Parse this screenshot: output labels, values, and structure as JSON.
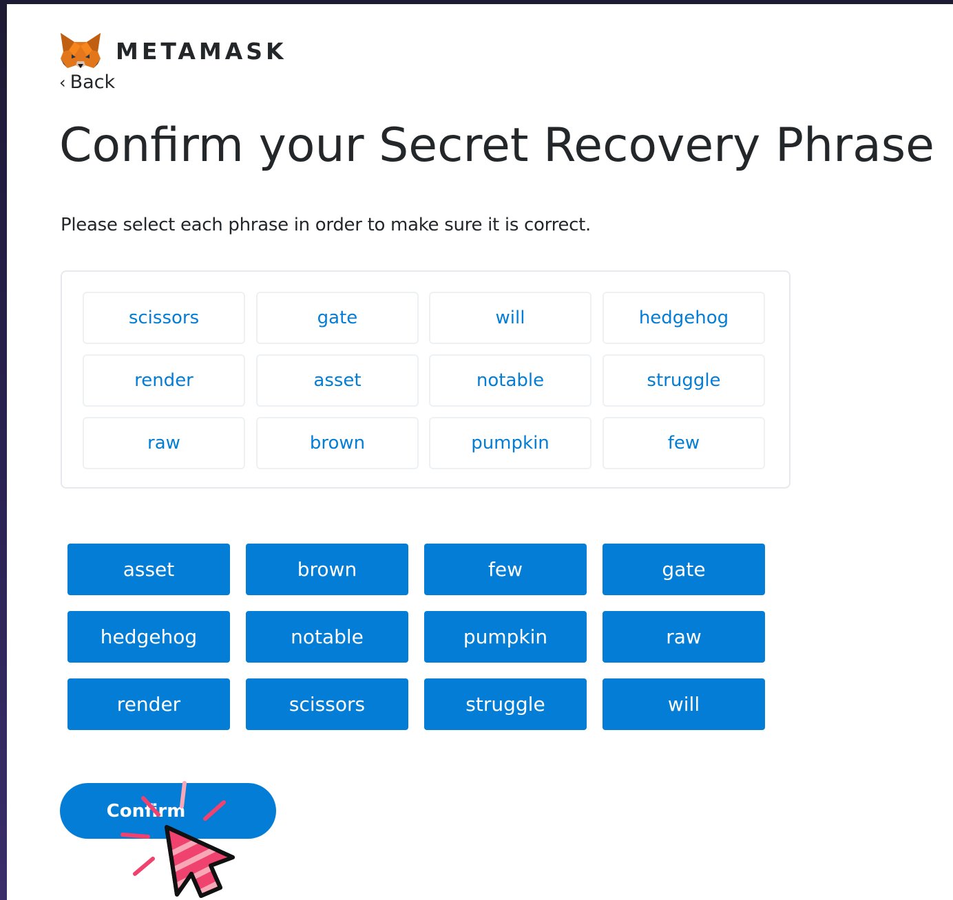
{
  "colors": {
    "primary_blue": "#037dd6",
    "text_dark": "#24272a",
    "border_light": "#e6e9ed",
    "cursor_pink": "#f0426e",
    "cursor_light_pink": "#f8a7b6",
    "frame_dark": "#1d1a33"
  },
  "brand": {
    "logo_icon": "metamask-fox-icon",
    "name": "METAMASK"
  },
  "nav": {
    "back_icon": "chevron-left-icon",
    "back_label": "Back"
  },
  "page": {
    "title": "Confirm your Secret Recovery Phrase",
    "instruction": "Please select each phrase in order to make sure it is correct."
  },
  "selected_words": [
    "scissors",
    "gate",
    "will",
    "hedgehog",
    "render",
    "asset",
    "notable",
    "struggle",
    "raw",
    "brown",
    "pumpkin",
    "few"
  ],
  "word_options": [
    "asset",
    "brown",
    "few",
    "gate",
    "hedgehog",
    "notable",
    "pumpkin",
    "raw",
    "render",
    "scissors",
    "struggle",
    "will"
  ],
  "confirm": {
    "label": "Confirm"
  },
  "overlay": {
    "cursor_icon": "pointer-cursor-icon",
    "click_effect_icon": "click-burst-icon"
  }
}
